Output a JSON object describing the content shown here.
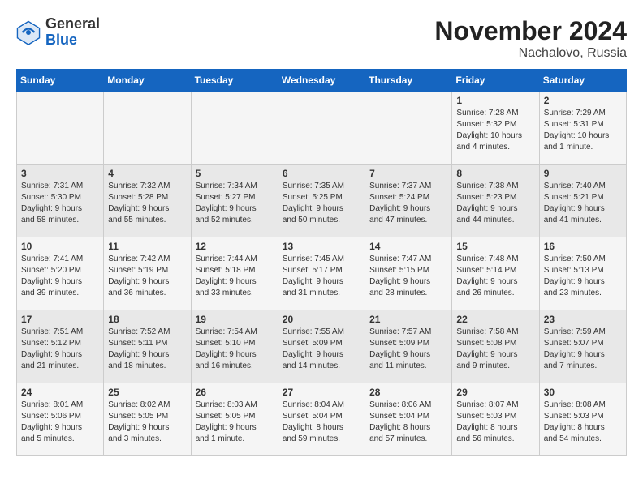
{
  "header": {
    "logo_general": "General",
    "logo_blue": "Blue",
    "month_title": "November 2024",
    "location": "Nachalovo, Russia"
  },
  "calendar": {
    "days_of_week": [
      "Sunday",
      "Monday",
      "Tuesday",
      "Wednesday",
      "Thursday",
      "Friday",
      "Saturday"
    ],
    "weeks": [
      [
        {
          "day": "",
          "info": ""
        },
        {
          "day": "",
          "info": ""
        },
        {
          "day": "",
          "info": ""
        },
        {
          "day": "",
          "info": ""
        },
        {
          "day": "",
          "info": ""
        },
        {
          "day": "1",
          "info": "Sunrise: 7:28 AM\nSunset: 5:32 PM\nDaylight: 10 hours\nand 4 minutes."
        },
        {
          "day": "2",
          "info": "Sunrise: 7:29 AM\nSunset: 5:31 PM\nDaylight: 10 hours\nand 1 minute."
        }
      ],
      [
        {
          "day": "3",
          "info": "Sunrise: 7:31 AM\nSunset: 5:30 PM\nDaylight: 9 hours\nand 58 minutes."
        },
        {
          "day": "4",
          "info": "Sunrise: 7:32 AM\nSunset: 5:28 PM\nDaylight: 9 hours\nand 55 minutes."
        },
        {
          "day": "5",
          "info": "Sunrise: 7:34 AM\nSunset: 5:27 PM\nDaylight: 9 hours\nand 52 minutes."
        },
        {
          "day": "6",
          "info": "Sunrise: 7:35 AM\nSunset: 5:25 PM\nDaylight: 9 hours\nand 50 minutes."
        },
        {
          "day": "7",
          "info": "Sunrise: 7:37 AM\nSunset: 5:24 PM\nDaylight: 9 hours\nand 47 minutes."
        },
        {
          "day": "8",
          "info": "Sunrise: 7:38 AM\nSunset: 5:23 PM\nDaylight: 9 hours\nand 44 minutes."
        },
        {
          "day": "9",
          "info": "Sunrise: 7:40 AM\nSunset: 5:21 PM\nDaylight: 9 hours\nand 41 minutes."
        }
      ],
      [
        {
          "day": "10",
          "info": "Sunrise: 7:41 AM\nSunset: 5:20 PM\nDaylight: 9 hours\nand 39 minutes."
        },
        {
          "day": "11",
          "info": "Sunrise: 7:42 AM\nSunset: 5:19 PM\nDaylight: 9 hours\nand 36 minutes."
        },
        {
          "day": "12",
          "info": "Sunrise: 7:44 AM\nSunset: 5:18 PM\nDaylight: 9 hours\nand 33 minutes."
        },
        {
          "day": "13",
          "info": "Sunrise: 7:45 AM\nSunset: 5:17 PM\nDaylight: 9 hours\nand 31 minutes."
        },
        {
          "day": "14",
          "info": "Sunrise: 7:47 AM\nSunset: 5:15 PM\nDaylight: 9 hours\nand 28 minutes."
        },
        {
          "day": "15",
          "info": "Sunrise: 7:48 AM\nSunset: 5:14 PM\nDaylight: 9 hours\nand 26 minutes."
        },
        {
          "day": "16",
          "info": "Sunrise: 7:50 AM\nSunset: 5:13 PM\nDaylight: 9 hours\nand 23 minutes."
        }
      ],
      [
        {
          "day": "17",
          "info": "Sunrise: 7:51 AM\nSunset: 5:12 PM\nDaylight: 9 hours\nand 21 minutes."
        },
        {
          "day": "18",
          "info": "Sunrise: 7:52 AM\nSunset: 5:11 PM\nDaylight: 9 hours\nand 18 minutes."
        },
        {
          "day": "19",
          "info": "Sunrise: 7:54 AM\nSunset: 5:10 PM\nDaylight: 9 hours\nand 16 minutes."
        },
        {
          "day": "20",
          "info": "Sunrise: 7:55 AM\nSunset: 5:09 PM\nDaylight: 9 hours\nand 14 minutes."
        },
        {
          "day": "21",
          "info": "Sunrise: 7:57 AM\nSunset: 5:09 PM\nDaylight: 9 hours\nand 11 minutes."
        },
        {
          "day": "22",
          "info": "Sunrise: 7:58 AM\nSunset: 5:08 PM\nDaylight: 9 hours\nand 9 minutes."
        },
        {
          "day": "23",
          "info": "Sunrise: 7:59 AM\nSunset: 5:07 PM\nDaylight: 9 hours\nand 7 minutes."
        }
      ],
      [
        {
          "day": "24",
          "info": "Sunrise: 8:01 AM\nSunset: 5:06 PM\nDaylight: 9 hours\nand 5 minutes."
        },
        {
          "day": "25",
          "info": "Sunrise: 8:02 AM\nSunset: 5:05 PM\nDaylight: 9 hours\nand 3 minutes."
        },
        {
          "day": "26",
          "info": "Sunrise: 8:03 AM\nSunset: 5:05 PM\nDaylight: 9 hours\nand 1 minute."
        },
        {
          "day": "27",
          "info": "Sunrise: 8:04 AM\nSunset: 5:04 PM\nDaylight: 8 hours\nand 59 minutes."
        },
        {
          "day": "28",
          "info": "Sunrise: 8:06 AM\nSunset: 5:04 PM\nDaylight: 8 hours\nand 57 minutes."
        },
        {
          "day": "29",
          "info": "Sunrise: 8:07 AM\nSunset: 5:03 PM\nDaylight: 8 hours\nand 56 minutes."
        },
        {
          "day": "30",
          "info": "Sunrise: 8:08 AM\nSunset: 5:03 PM\nDaylight: 8 hours\nand 54 minutes."
        }
      ]
    ]
  }
}
